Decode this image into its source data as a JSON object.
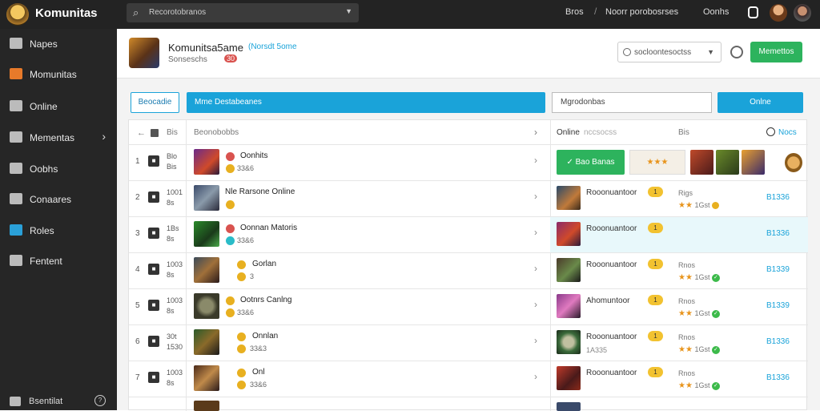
{
  "topbar": {
    "app_name": "Komunitas",
    "search_text": "Recorotobranos",
    "nav": [
      "Bros",
      "Noorr porobosrses",
      "Oonhs"
    ]
  },
  "sidebar": {
    "items": [
      {
        "label": "Napes"
      },
      {
        "label": "Momunitas"
      },
      {
        "label": "Online"
      },
      {
        "label": "Mementas"
      },
      {
        "label": "Oobhs"
      },
      {
        "label": "Conaares"
      },
      {
        "label": "Roles"
      },
      {
        "label": "Fentent"
      }
    ],
    "footer_label": "Bsentilat"
  },
  "header": {
    "title": "Komunitsa5ame",
    "link": "(Norsdt 5ome",
    "subtitle": "Sonseschs",
    "badge": "30",
    "select_text": "socloontesoctss",
    "button": "Memettos"
  },
  "filters": {
    "genre": "Beocadie",
    "bar": "Mme Destabeanes",
    "input": "Mgrodonbas",
    "online": "Onlne"
  },
  "table": {
    "headers": {
      "col_a": "Beonobobbs",
      "col_b": "Online",
      "col_b_sub": "nccsocss",
      "col_c": "Bis",
      "col_d": "Nocs"
    },
    "rows": [
      {
        "num": "1",
        "rank": "Blo\nBis",
        "name": "Oonhits",
        "meta": "33&6",
        "right_green": "Bao Banas"
      },
      {
        "num": "2",
        "rank": "1001\n8s",
        "name": "Nle Rarsone Online",
        "meta": "",
        "rname": "Rooonuantoor",
        "rsub": "",
        "rmeta1": "Rigs",
        "rmeta2": "1Gst",
        "rnum": "B1336"
      },
      {
        "num": "3",
        "rank": "1Bs\n8s",
        "name": "Oonnan Matoris",
        "meta": "33&6",
        "rname": "Rooonuantoor",
        "rsub": "",
        "rmeta1": "",
        "rmeta2": "",
        "rnum": "B1336"
      },
      {
        "num": "4",
        "rank": "1003\n8s",
        "name": "Gorlan",
        "meta": "3",
        "rname": "Rooonuantoor",
        "rsub": "",
        "rmeta1": "Rnos",
        "rmeta2": "1Gst",
        "rnum": "B1339"
      },
      {
        "num": "5",
        "rank": "1003\n8s",
        "name": "Ootnrs Canlng",
        "meta": "33&6",
        "rname": "Ahomuntoor",
        "rsub": "",
        "rmeta1": "Rnos",
        "rmeta2": "1Gst",
        "rnum": "B1339"
      },
      {
        "num": "6",
        "rank": "30t\n1530",
        "name": "Onnlan",
        "meta": "33&3",
        "rname": "Rooonuantoor",
        "rsub": "1A335",
        "rmeta1": "Rnos",
        "rmeta2": "1Gst",
        "rnum": "B1336"
      },
      {
        "num": "7",
        "rank": "1003\n8s",
        "name": "Onl",
        "meta": "33&6",
        "rname": "Rooonuantoor",
        "rsub": "",
        "rmeta1": "Rnos",
        "rmeta2": "1Gst",
        "rnum": "B1336"
      }
    ]
  },
  "colors": {
    "accent": "#1aa3d9",
    "green": "#2db35d",
    "sidebar": "#262626",
    "topbar": "#232323"
  }
}
